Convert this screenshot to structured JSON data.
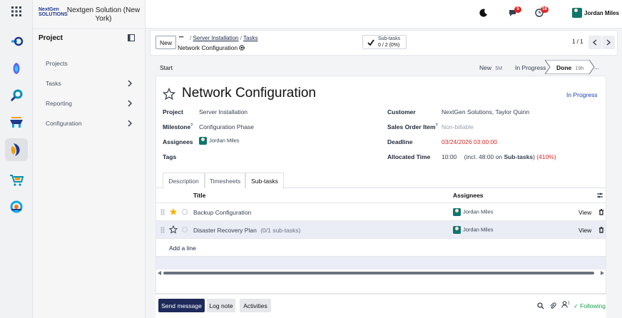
{
  "brand": {
    "logo_text": "NextGen SOLUTIONS",
    "company_name": "Nextgen Solution (New York)"
  },
  "side_menu": {
    "title": "Project",
    "items": [
      {
        "label": "Projects",
        "has_submenu": false
      },
      {
        "label": "Tasks",
        "has_submenu": true
      },
      {
        "label": "Reporting",
        "has_submenu": true
      },
      {
        "label": "Configuration",
        "has_submenu": true
      }
    ]
  },
  "topbar": {
    "messages_badge": "5",
    "activities_badge": "18",
    "user_name": "Jordan Miles"
  },
  "control_panel": {
    "new_label": "New",
    "more_label": "•••",
    "breadcrumb": [
      "Server Installation",
      "Tasks"
    ],
    "record_name": "Network Configuration",
    "subtasks_label": "Sub-tasks",
    "subtasks_count": "0 / 2 (0%)",
    "pager": "1 / 1"
  },
  "statusbar": {
    "start_label": "Start",
    "stages": [
      {
        "label": "New",
        "suffix": "5M"
      },
      {
        "label": "In Progress",
        "suffix": ""
      },
      {
        "label": "Done",
        "suffix": "19h"
      }
    ],
    "more": "..."
  },
  "task": {
    "title": "Network Configuration",
    "state": "In Progress",
    "left_fields": [
      {
        "label": "Project",
        "value": "Server Installation"
      },
      {
        "label": "Milestone",
        "value": "Configuration Phase"
      },
      {
        "label": "Assignees",
        "value": "Jordan Miles"
      },
      {
        "label": "Tags",
        "value": ""
      }
    ],
    "right_fields": {
      "customer_label": "Customer",
      "customer_value": "NextGen Solutions, Taylor Quinn",
      "sol_label": "Sales Order Item",
      "sol_placeholder": "Non-billable",
      "deadline_label": "Deadline",
      "deadline_value": "03/24/2026 03:00:00",
      "allocated_label": "Allocated Time",
      "allocated_value": "10:00",
      "allocated_incl_prefix": "(incl. 48:00 on",
      "allocated_incl_bold": "Sub-tasks",
      "allocated_incl_suffix": ")",
      "allocated_percent": "(410%)"
    },
    "help_mark": "?"
  },
  "tabs": [
    "Description",
    "Timesheets",
    "Sub-tasks"
  ],
  "subtasks": {
    "col_title": "Title",
    "col_assignees": "Assignees",
    "rows": [
      {
        "title": "Backup Configuration",
        "extra": "",
        "starred": true,
        "assignee": "Jordan Miles",
        "view": "View"
      },
      {
        "title": "Disaster Recovery Plan",
        "extra": "(0/1 sub-tasks)",
        "starred": false,
        "assignee": "Jordan Miles",
        "view": "View"
      }
    ],
    "add_line": "Add a line"
  },
  "chatter": {
    "send_message": "Send message",
    "log_note": "Log note",
    "activities": "Activities",
    "followers_count": "1",
    "following": "Following"
  },
  "colors": {
    "primary": "#1e2a5a",
    "accent_blue": "#1e40af",
    "danger": "#dc2626",
    "success": "#16a34a",
    "star": "#f5b301"
  }
}
